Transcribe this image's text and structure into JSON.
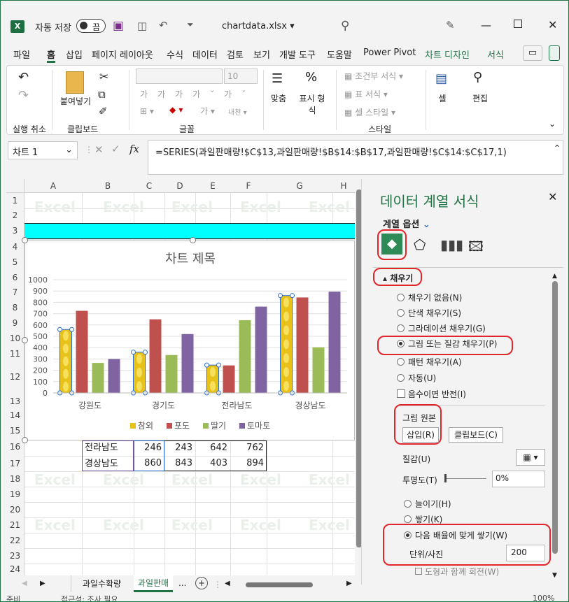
{
  "titlebar": {
    "logo": "X",
    "autosave_label": "자동 저장",
    "toggle_state": "끔",
    "file_name": "chartdata.xlsx ▾",
    "icons": [
      "save-icon",
      "camera-icon",
      "undo-icon",
      "customize-icon",
      "search-icon",
      "pen-icon",
      "minimize-icon",
      "maximize-icon",
      "close-icon"
    ]
  },
  "tabs": [
    "파일",
    "홈",
    "삽입",
    "페이지 레이아웃",
    "수식",
    "데이터",
    "검토",
    "보기",
    "개발 도구",
    "도움말",
    "Power Pivot",
    "차트 디자인",
    "서식"
  ],
  "ribbon": {
    "undo_group": "실행 취소",
    "clipboard_group": "클립보드",
    "paste_label": "붙여넣기",
    "font_group": "글꼴",
    "font_size": "10",
    "font_buttons": [
      "가",
      "가",
      "가",
      "가˘",
      "가ˇ"
    ],
    "align_label": "맞춤",
    "number_label": "표시 형식",
    "styles_group": "스타일",
    "cond_format": "조건부 서식",
    "table_format": "표 서식",
    "cell_style": "셀 스타일",
    "cells_label": "셀",
    "edit_label": "편집"
  },
  "formula": {
    "name_box": "차트 1",
    "fx_label": "fx",
    "formula": "=SERIES(과일판매량!$C$13,과일판매량!$B$14:$B$17,과일판매량!$C$14:$C$17,1)"
  },
  "sheet": {
    "columns": [
      "A",
      "B",
      "C",
      "D",
      "E",
      "F",
      "G",
      "H"
    ],
    "rows": [
      "1",
      "2",
      "3",
      "4",
      "5",
      "6",
      "7",
      "8",
      "9",
      "10",
      "11",
      "12",
      "13",
      "14",
      "15",
      "16",
      "17",
      "18",
      "19",
      "20",
      "21",
      "22",
      "23",
      "24"
    ],
    "watermark": "Excel",
    "table_rows": [
      {
        "name": "전라남도",
        "v1": "246",
        "v2": "243",
        "v3": "642",
        "v4": "762"
      },
      {
        "name": "경상남도",
        "v1": "860",
        "v2": "843",
        "v3": "403",
        "v4": "894"
      }
    ]
  },
  "chart_data": {
    "type": "bar",
    "title": "차트 제목",
    "categories": [
      "강원도",
      "경기도",
      "전라남도",
      "경상남도"
    ],
    "ylim": [
      0,
      1000
    ],
    "yticks": [
      "1000",
      "900",
      "800",
      "700",
      "600",
      "500",
      "400",
      "300",
      "200",
      "100",
      "0"
    ],
    "series": [
      {
        "name": "참외",
        "values": [
          560,
          360,
          246,
          860
        ],
        "color": "#e8c21a"
      },
      {
        "name": "포도",
        "values": [
          725,
          650,
          243,
          843
        ],
        "color": "#c0504d"
      },
      {
        "name": "딸기",
        "values": [
          265,
          335,
          642,
          403
        ],
        "color": "#9bbb59"
      },
      {
        "name": "토마토",
        "values": [
          300,
          520,
          762,
          894
        ],
        "color": "#8064a2"
      }
    ],
    "legend": "bottom",
    "grid": true
  },
  "pane": {
    "title": "데이터 계열 서식",
    "series_options": "계열 옵션",
    "fill_header": "채우기",
    "fill_options": [
      "채우기 없음(N)",
      "단색 채우기(S)",
      "그라데이션 채우기(G)",
      "그림 또는 질감 채우기(P)",
      "패턴 채우기(A)",
      "자동(U)"
    ],
    "selected_fill": 3,
    "invert_label": "음수이면 반전(I)",
    "picture_source": "그림 원본",
    "insert_btn": "삽입(R)",
    "clipboard_btn": "클립보드(C)",
    "texture_label": "질감(U)",
    "transparency_label": "투명도(T)",
    "transparency_value": "0%",
    "stretch_label": "늘이기(H)",
    "stack_label": "쌓기(K)",
    "stack_scale_label": "다음 배율에 맞게 쌓기(W)",
    "unit_label": "단위/사진",
    "unit_value": "200",
    "rotate_label": "도형과 함께 회전(W)",
    "close": "✕"
  },
  "sheettabs": {
    "tabs": [
      "과일수확량",
      "과일판매"
    ],
    "more": "...",
    "add": "+"
  },
  "status": {
    "ready": "준비",
    "accessibility": "접근성: 조사 필요",
    "zoom": "100%"
  }
}
